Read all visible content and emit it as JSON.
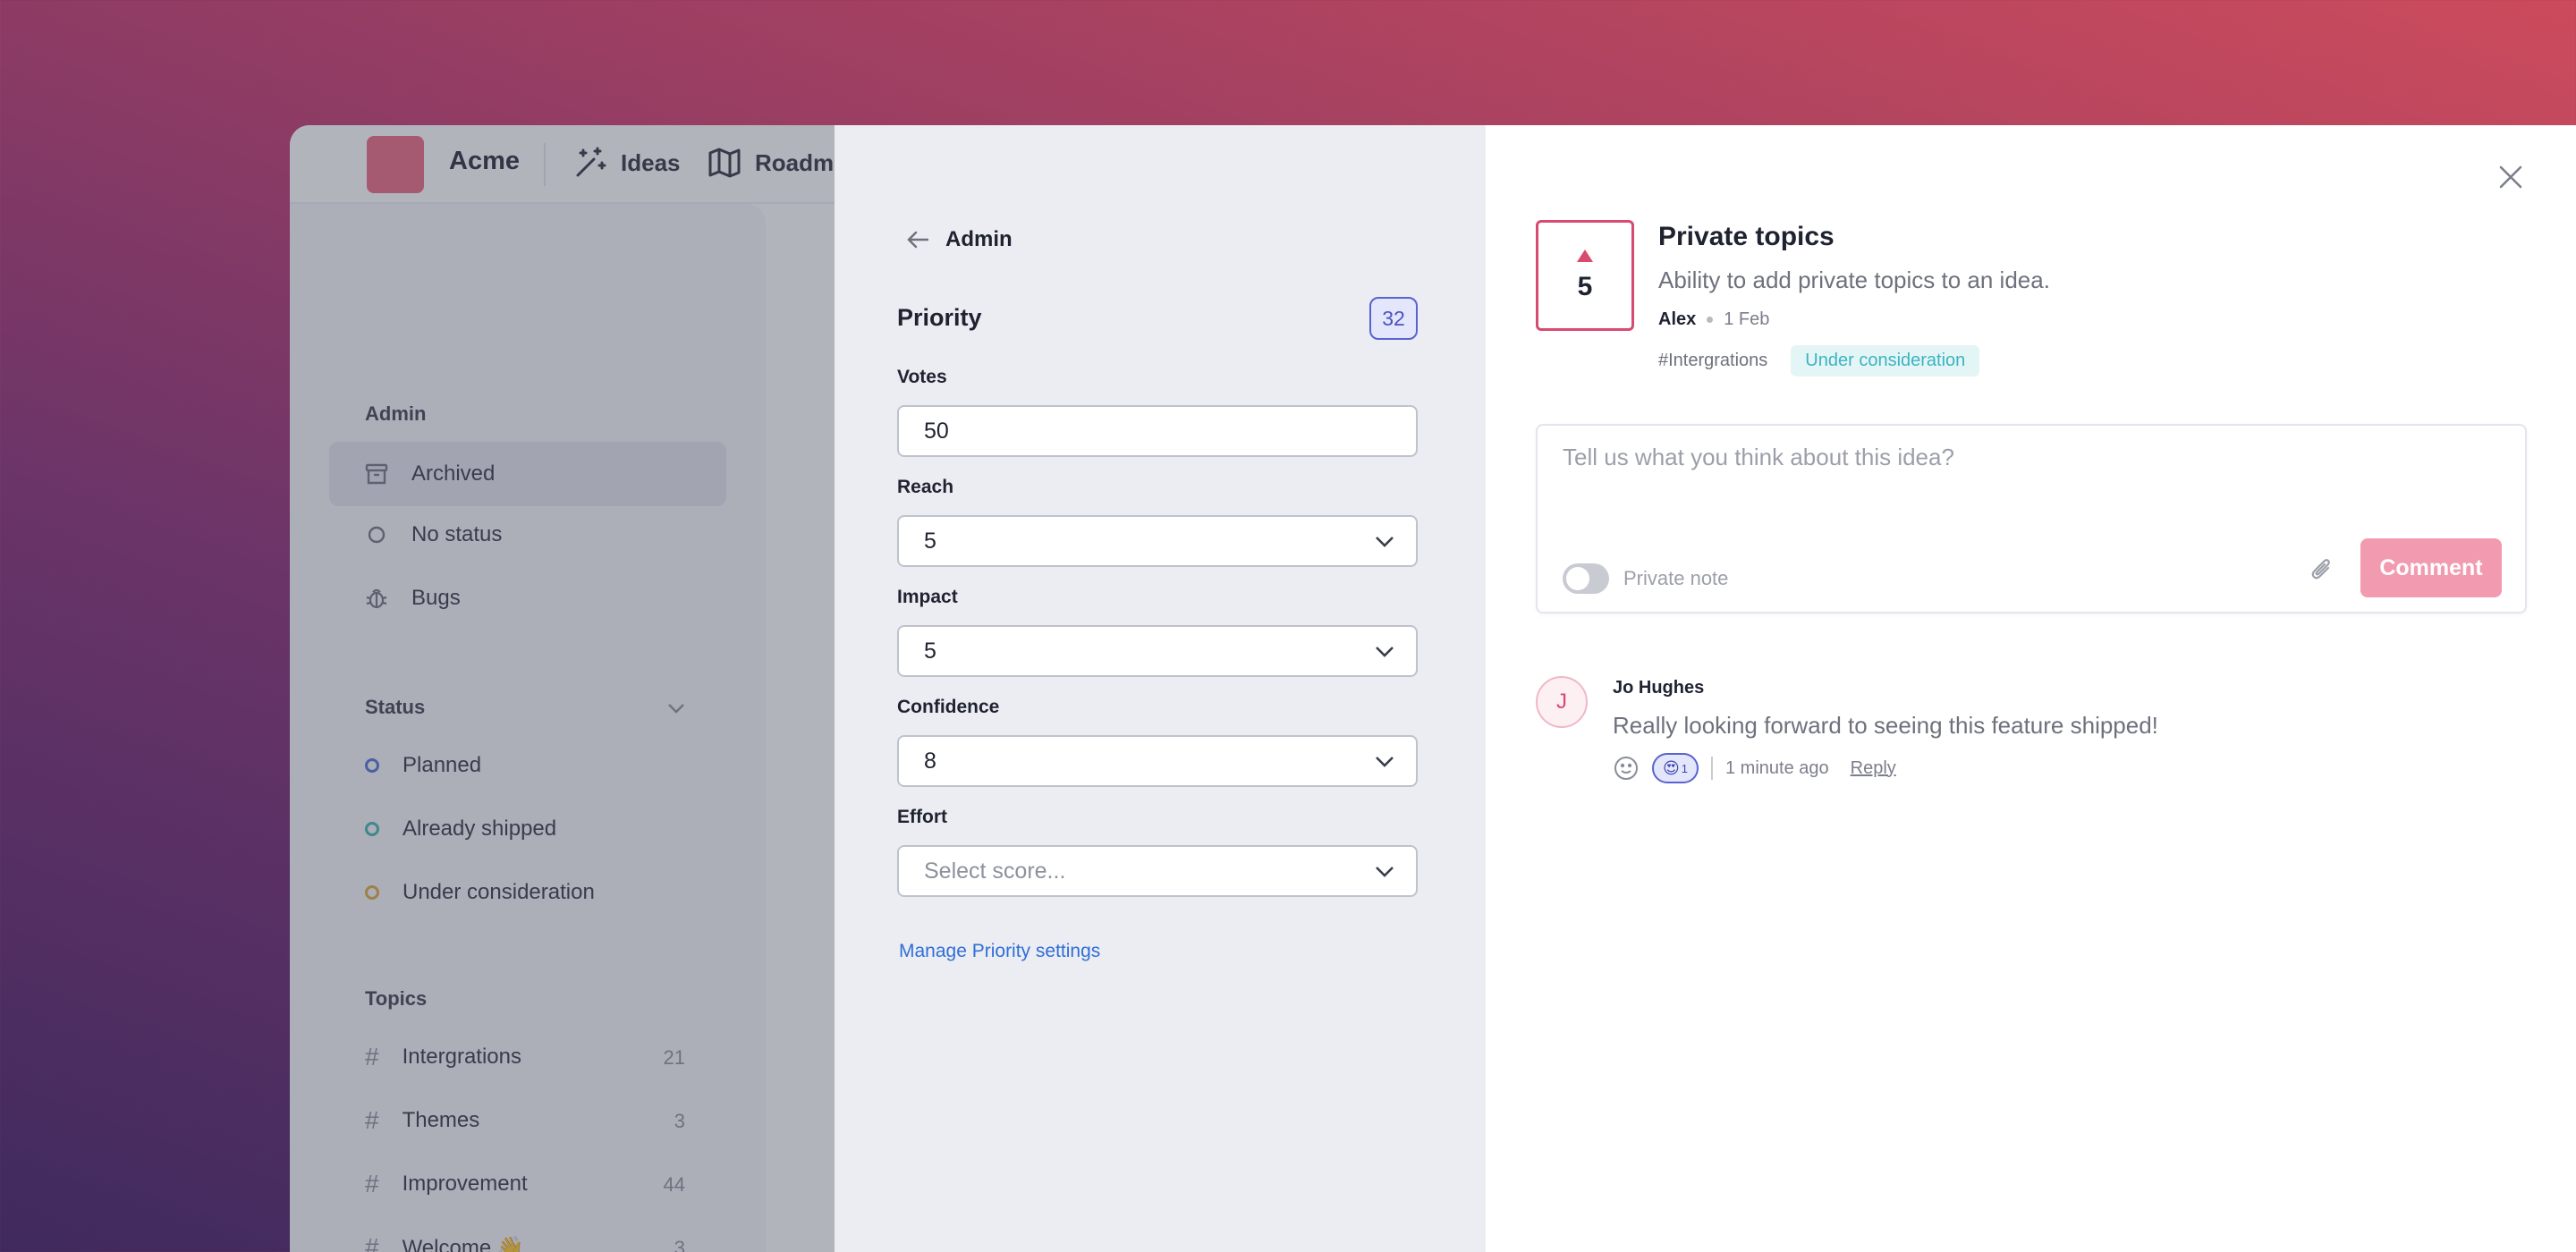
{
  "app": {
    "brand": "Acme",
    "nav": [
      {
        "label": "Ideas",
        "icon": "magic-wand-icon"
      },
      {
        "label": "Roadmap",
        "icon": "map-icon"
      }
    ]
  },
  "sidebar": {
    "admin_heading": "Admin",
    "admin_items": [
      {
        "label": "Archived",
        "icon": "archive-icon"
      },
      {
        "label": "No status",
        "icon": "circle-icon"
      },
      {
        "label": "Bugs",
        "icon": "bug-icon"
      }
    ],
    "status_heading": "Status",
    "status_items": [
      {
        "label": "Planned",
        "color": "#4a6fd6"
      },
      {
        "label": "Already shipped",
        "color": "#3bb4a8"
      },
      {
        "label": "Under consideration",
        "color": "#d9a83a"
      }
    ],
    "topics_heading": "Topics",
    "topics": [
      {
        "label": "Intergrations",
        "count": "21"
      },
      {
        "label": "Themes",
        "count": "3"
      },
      {
        "label": "Improvement",
        "count": "44"
      },
      {
        "label": "Welcome 👋",
        "count": "3"
      }
    ]
  },
  "admin_panel": {
    "back_label": "Admin",
    "priority_title": "Priority",
    "priority_score": "32",
    "fields": {
      "votes": {
        "label": "Votes",
        "value": "50"
      },
      "reach": {
        "label": "Reach",
        "value": "5"
      },
      "impact": {
        "label": "Impact",
        "value": "5"
      },
      "confidence": {
        "label": "Confidence",
        "value": "8"
      },
      "effort": {
        "label": "Effort",
        "placeholder": "Select score..."
      }
    },
    "manage_link": "Manage Priority settings"
  },
  "idea": {
    "votes": "5",
    "title": "Private topics",
    "description": "Ability to add private topics to an idea.",
    "author": "Alex",
    "date": "1 Feb",
    "topic_tag": "#Intergrations",
    "status": "Under consideration"
  },
  "composer": {
    "placeholder": "Tell us what you think about this idea?",
    "private_note_label": "Private note",
    "submit_label": "Comment"
  },
  "comments": [
    {
      "avatar_initial": "J",
      "author": "Jo Hughes",
      "text": "Really looking forward to seeing this feature shipped!",
      "reaction_emoji": "😍",
      "reaction_count": "1",
      "time": "1 minute ago",
      "reply_label": "Reply"
    }
  ],
  "colors": {
    "accent_pink": "#d84a70",
    "button_pink": "#f29bb0",
    "link_blue": "#2f6fd6",
    "badge_indigo": "#5a62d0",
    "status_teal": "#3bb4c1"
  }
}
